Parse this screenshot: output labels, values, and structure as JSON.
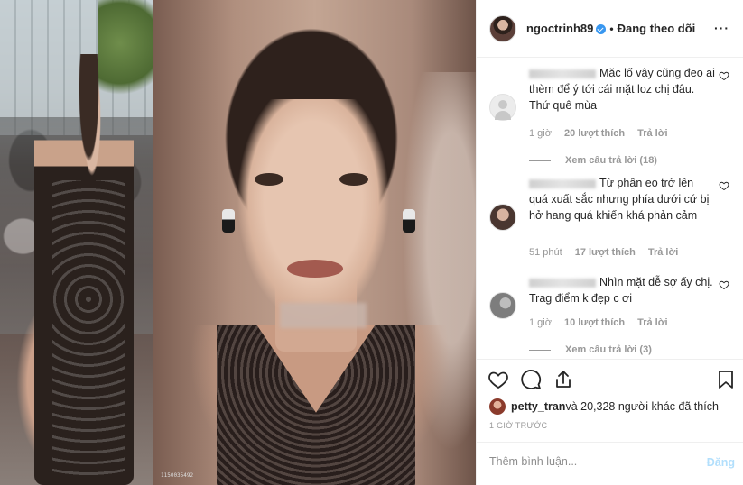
{
  "header": {
    "username": "ngoctrinh89",
    "separator": "•",
    "follow_status": "Đang theo dõi",
    "more_icon": "more-horizontal-icon"
  },
  "media": {
    "watermark": "1150035492"
  },
  "comments": [
    {
      "text": "Mặc lố vậy cũng đeo ai thèm để ý tới cái mặt loz chị đâu. Thứ quê mùa",
      "time": "1 giờ",
      "likes": "20 lượt thích",
      "reply": "Trả lời",
      "view_replies": "Xem câu trả lời (18)"
    },
    {
      "text": "Từ phần eo trở lên quá xuất sắc nhưng phía dưới cứ bị hở hang quá khiến khá phản cảm",
      "time": "51 phút",
      "likes": "17 lượt thích",
      "reply": "Trả lời",
      "view_replies": ""
    },
    {
      "text": "Nhìn mặt dễ sợ ấy chị. Trag điểm k đẹp c ơi",
      "time": "1 giờ",
      "likes": "10 lượt thích",
      "reply": "Trả lời",
      "view_replies": "Xem câu trả lời (3)"
    }
  ],
  "likes": {
    "user": "petty_tran",
    "rest": " và 20,328 người khác đã thích"
  },
  "timeago": "1 GIỜ TRƯỚC",
  "add_comment": {
    "placeholder": "Thêm bình luận...",
    "post": "Đăng"
  },
  "colors": {
    "link_blue": "#3897f0",
    "post_disabled": "#b2dffc",
    "meta_gray": "#999999"
  }
}
